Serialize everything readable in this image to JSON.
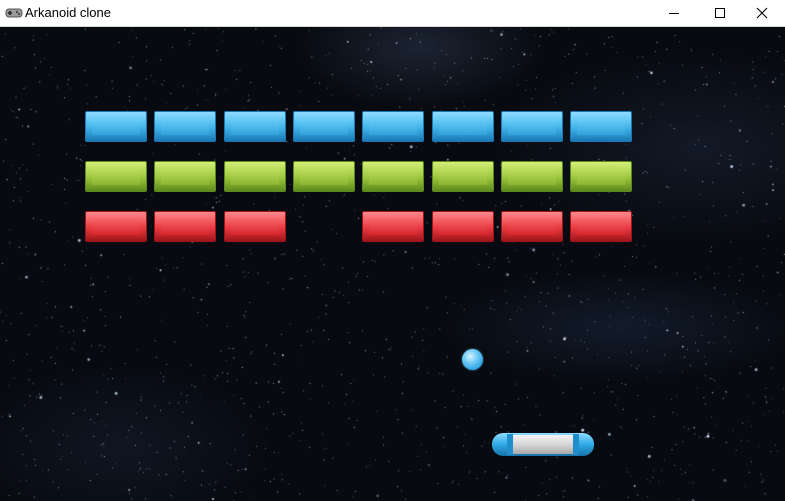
{
  "window": {
    "title": "Arkanoid clone",
    "controls": {
      "minimize": "minimize",
      "maximize": "maximize",
      "close": "close"
    }
  },
  "colors": {
    "blue": "#3fb4e8",
    "green": "#9bc53d",
    "red": "#e83a3f",
    "background": "#070a10",
    "paddle_body": "#dcdcdc",
    "paddle_caps": "#2fa9e6",
    "ball": "#4fbcf0"
  },
  "game": {
    "rows": [
      {
        "color": "blue",
        "bricks": [
          1,
          1,
          1,
          1,
          1,
          1,
          1,
          1
        ]
      },
      {
        "color": "green",
        "bricks": [
          1,
          1,
          1,
          1,
          1,
          1,
          1,
          1
        ]
      },
      {
        "color": "red",
        "bricks": [
          1,
          1,
          1,
          0,
          1,
          1,
          1,
          1
        ]
      }
    ]
  }
}
